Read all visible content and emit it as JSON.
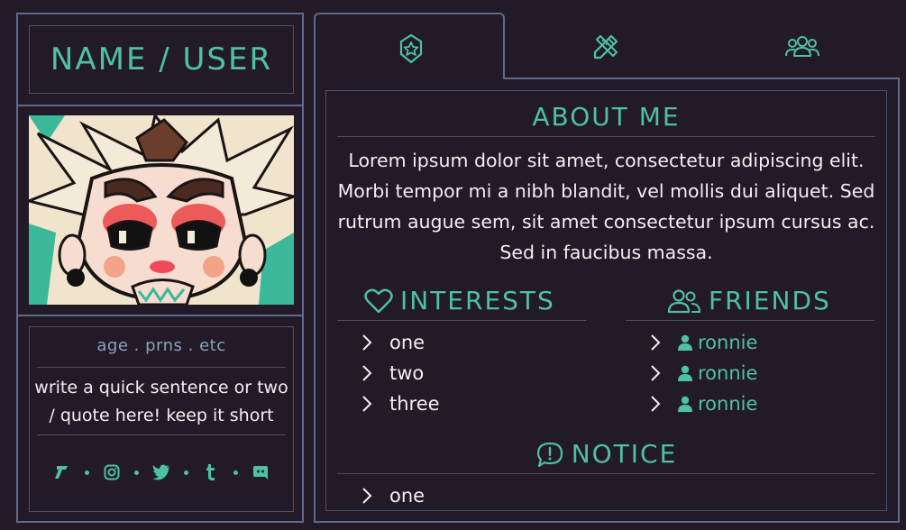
{
  "profile": {
    "name": "NAME / USER",
    "meta": "age . prns . etc",
    "quote": "write a quick sentence or two / quote here! keep it short",
    "socials": [
      "toyhouse-icon",
      "instagram-icon",
      "twitter-icon",
      "tumblr-icon",
      "discord-icon"
    ]
  },
  "tabs": [
    {
      "icon": "star-badge-icon",
      "active": true
    },
    {
      "icon": "pencil-ruler-icon",
      "active": false
    },
    {
      "icon": "group-icon",
      "active": false
    }
  ],
  "about": {
    "title": "ABOUT ME",
    "text": "Lorem ipsum dolor sit amet, consectetur adipiscing elit. Morbi tempor mi a nibh blandit, vel mollis dui aliquet. Sed rutrum augue sem, sit amet consectetur ipsum cursus ac. Sed in faucibus massa."
  },
  "interests": {
    "title": "INTERESTS",
    "items": [
      "one",
      "two",
      "three"
    ]
  },
  "friends": {
    "title": "FRIENDS",
    "items": [
      "ronnie",
      "ronnie",
      "ronnie"
    ]
  },
  "notice": {
    "title": "NOTICE",
    "items": [
      "one"
    ]
  },
  "colors": {
    "background": "#221a26",
    "accent": "#4fc0a8",
    "border": "#5f6a8a",
    "muted": "#8aa2c0"
  }
}
